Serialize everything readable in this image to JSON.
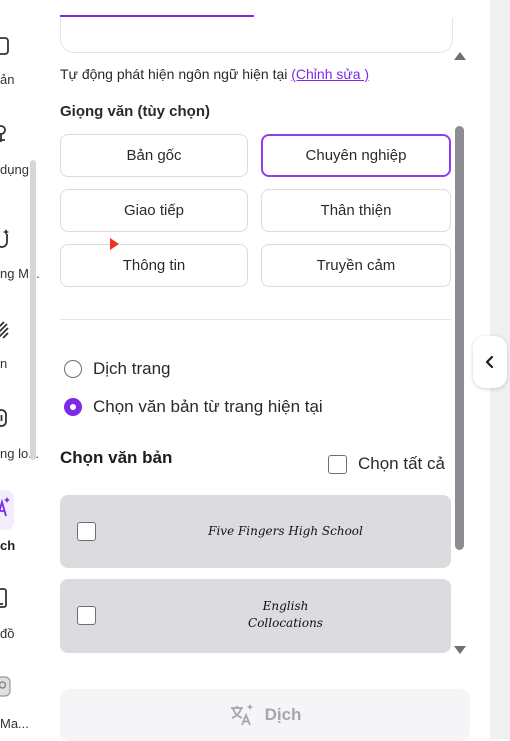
{
  "rail": {
    "items": [
      {
        "label": "ản",
        "icon": "page-icon"
      },
      {
        "label": "dụng",
        "icon": "apps-icon"
      },
      {
        "label": "ng M...",
        "icon": "magic-icon"
      },
      {
        "label": "n",
        "icon": "pattern-icon"
      },
      {
        "label": "ng lo...",
        "icon": "link-icon"
      },
      {
        "label": "ch",
        "icon": "sparkle-icon"
      },
      {
        "label": "đồ",
        "icon": "phone-icon"
      },
      {
        "label": "Ma...",
        "icon": "avatar-icon"
      }
    ]
  },
  "detect": {
    "text": "Tự động phát hiện ngôn ngữ hiện tại ",
    "edit_link": "(Chỉnh sửa )"
  },
  "tone": {
    "title": "Giọng văn (tùy chọn)",
    "options": [
      {
        "label": "Bản gốc",
        "selected": false
      },
      {
        "label": "Chuyên nghiệp",
        "selected": true
      },
      {
        "label": "Giao tiếp",
        "selected": false
      },
      {
        "label": "Thân thiện",
        "selected": false
      },
      {
        "label": "Thông tin",
        "selected": false
      },
      {
        "label": "Truyền cảm",
        "selected": false
      }
    ]
  },
  "scope": {
    "options": [
      {
        "label": "Dịch trang",
        "selected": false
      },
      {
        "label": "Chọn văn bản từ trang hiện tại",
        "selected": true
      }
    ]
  },
  "select_text": {
    "title": "Chọn văn bản",
    "select_all_label": "Chọn tất cả",
    "items": [
      {
        "text": "Five Fingers High School",
        "checked": false
      },
      {
        "text": "English\nCollocations",
        "checked": false
      }
    ]
  },
  "translate_button": {
    "label": "Dịch"
  },
  "colors": {
    "accent": "#7d2ae8",
    "card_bg": "#dcdce0",
    "marker": "#f2331a"
  }
}
